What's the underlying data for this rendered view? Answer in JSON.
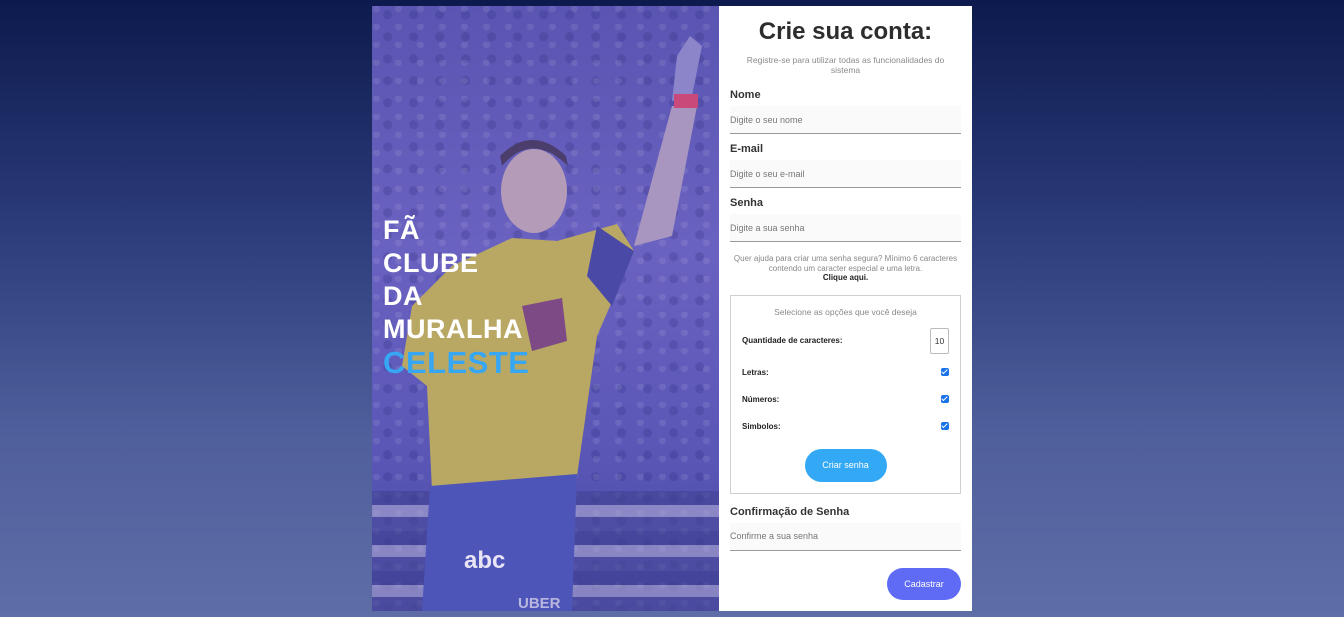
{
  "hero": {
    "lines": [
      "FÃ",
      "CLUBE",
      "DA",
      "MURALHA"
    ],
    "accent": "CELESTE"
  },
  "form": {
    "title": "Crie sua conta:",
    "subtitle": "Registre-se para utilizar todas as funcionalidades do sistema",
    "fields": {
      "name": {
        "label": "Nome",
        "placeholder": "Digite o seu nome"
      },
      "email": {
        "label": "E-mail",
        "placeholder": "Digite o seu e-mail"
      },
      "password": {
        "label": "Senha",
        "placeholder": "Digite a sua senha"
      },
      "confirm": {
        "label": "Confirmação de Senha",
        "placeholder": "Confirme a sua senha"
      }
    },
    "help_text": "Quer ajuda para criar uma senha segura? Mínimo 6 caracteres contendo um caracter especial e uma letra.",
    "help_link": "Clique aqui.",
    "generator": {
      "title": "Selecione as opções que você deseja",
      "length_label": "Quantidade de caracteres:",
      "length_value": "10",
      "options": [
        {
          "label": "Letras:",
          "checked": true
        },
        {
          "label": "Números:",
          "checked": true
        },
        {
          "label": "Simbolos:",
          "checked": true
        }
      ],
      "button": "Criar senha"
    },
    "submit": "Cadastrar"
  },
  "colors": {
    "accent_blue": "#37a6f3",
    "submit_purple": "#5f6af5",
    "generate_blue": "#33a8f5"
  }
}
